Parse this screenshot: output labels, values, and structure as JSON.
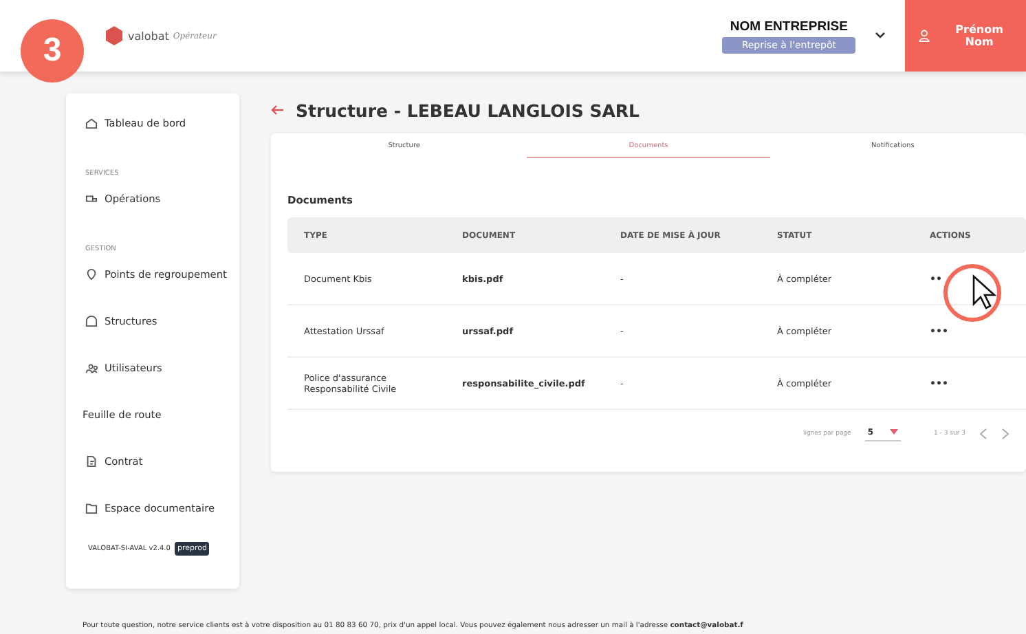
{
  "step_badge": "3",
  "header": {
    "logo_text": "valobat",
    "logo_subtitle": "Opérateur",
    "company": "NOM ENTREPRISE",
    "company_tag": "Reprise à l'entrepôt",
    "user": "Prénom Nom"
  },
  "sidebar": {
    "items": [
      {
        "kind": "link",
        "label": "Tableau de bord"
      },
      {
        "kind": "section",
        "label": "SERVICES"
      },
      {
        "kind": "link",
        "label": "Opérations"
      },
      {
        "kind": "section",
        "label": "GESTION"
      },
      {
        "kind": "link",
        "label": "Points de regroupement"
      },
      {
        "kind": "link",
        "label": "Structures"
      },
      {
        "kind": "link",
        "label": "Utilisateurs"
      },
      {
        "kind": "plain",
        "label": "Feuille de route"
      },
      {
        "kind": "link",
        "label": "Contrat"
      },
      {
        "kind": "link",
        "label": "Espace documentaire"
      }
    ],
    "version": "VALOBAT-SI-AVAL v2.4.0",
    "env_badge": "preprod"
  },
  "page_title": "Structure - LEBEAU LANGLOIS SARL",
  "tabs": [
    {
      "label": "Structure",
      "selected": false
    },
    {
      "label": "Documents",
      "selected": true
    },
    {
      "label": "Notifications",
      "selected": false
    }
  ],
  "section_title": "Documents",
  "table": {
    "columns": [
      "TYPE",
      "DOCUMENT",
      "DATE DE MISE À JOUR",
      "STATUT",
      "ACTIONS"
    ],
    "rows": [
      {
        "type": "Document Kbis",
        "document": "kbis.pdf",
        "date": "-",
        "status": "À compléter",
        "actions": "••"
      },
      {
        "type": "Attestation Urssaf",
        "document": "urssaf.pdf",
        "date": "-",
        "status": "À compléter",
        "actions": "•••"
      },
      {
        "type": "Police d'assurance Responsabilité Civile",
        "document": "responsabilite_civile.pdf",
        "date": "-",
        "status": "À compléter",
        "actions": "•••"
      }
    ]
  },
  "pagination": {
    "rows_per_page_label": "lignes par page",
    "rows_per_page": "5",
    "range": "1 - 3 sur 3"
  },
  "footer": "Pour toute question, notre service clients est à votre disposition au 01 80 83 60 70, prix d'un appel local. Vous pouvez également nous adresser un mail à l'adresse **contact@valobat.f**"
}
